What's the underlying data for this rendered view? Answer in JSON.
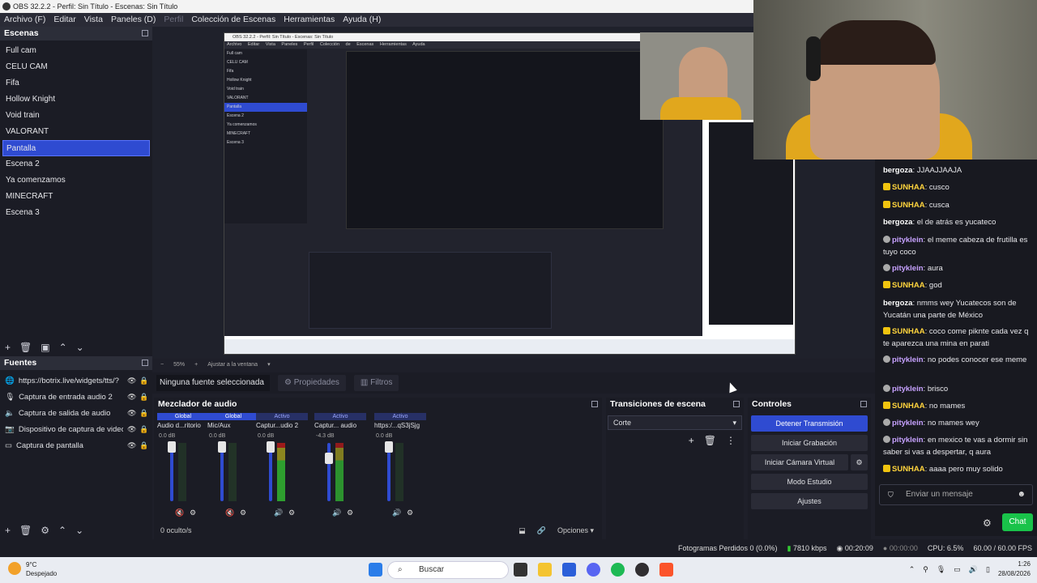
{
  "window": {
    "title": "OBS 32.2.2 - Perfil: Sin Título - Escenas: Sin Título"
  },
  "menu": [
    "Archivo (F)",
    "Editar",
    "Vista",
    "Paneles (D)",
    "Perfil",
    "Colección de Escenas",
    "Herramientas",
    "Ayuda (H)"
  ],
  "scenes": {
    "title": "Escenas",
    "items": [
      "Full cam",
      "CELU CAM",
      "Fifa",
      "Hollow Knight",
      "Void train",
      "VALORANT",
      "Pantalla",
      "Escena 2",
      "Ya comenzamos",
      "MINECRAFT",
      "Escena 3"
    ],
    "selected": "Pantalla"
  },
  "sources": {
    "title": "Fuentes",
    "items": [
      "https://botrix.live/widgets/tts/?",
      "Captura de entrada audio 2",
      "Captura de salida de audio",
      "Dispositivo de captura de video",
      "Captura de pantalla"
    ]
  },
  "preview_bar": {
    "zoom": "55%",
    "fit": "Ajustar a la ventana"
  },
  "context": {
    "no_source": "Ninguna fuente seleccionada",
    "properties": "Propiedades",
    "filters": "Filtros"
  },
  "mixer": {
    "title": "Mezclador de audio",
    "channels": [
      {
        "badge": "Global",
        "name": "Audio d...ritorio",
        "db": "0.0 dB",
        "level": 0.12
      },
      {
        "badge": "Global",
        "name": "Mic/Aux",
        "db": "0.0 dB",
        "level": 0.2
      },
      {
        "badge": "Activo",
        "name": "Captur...udio 2",
        "db": "0.0 dB",
        "level": 0.95
      },
      {
        "badge": "Activo",
        "name": "Captur... audio",
        "db": "-4.3 dB",
        "level": 0.8
      },
      {
        "badge": "Activo",
        "name": "https:/...qS3jSjg",
        "db": "0.0 dB",
        "level": 0.12
      }
    ],
    "scale": [
      "0",
      "-6",
      "-12",
      "-18",
      "-24",
      "-30",
      "-36",
      "-42",
      "-48",
      "-54",
      "-60"
    ],
    "hidden": "0 oculto/s",
    "options": "Opciones"
  },
  "transitions": {
    "title": "Transiciones de escena",
    "selected": "Corte"
  },
  "controls": {
    "title": "Controles",
    "buttons": [
      "Detener Transmisión",
      "Iniciar Grabación",
      "Iniciar Cámara Virtual",
      "Modo Estudio",
      "Ajustes"
    ]
  },
  "chat": {
    "messages": [
      {
        "user": "bergoza",
        "badge": "",
        "color": "white",
        "text": "JJAAJJAAJA"
      },
      {
        "user": "SUNHAA",
        "badge": "10",
        "color": "yellow",
        "text": "cusco"
      },
      {
        "user": "SUNHAA",
        "badge": "10",
        "color": "yellow",
        "text": "cusca"
      },
      {
        "user": "bergoza",
        "badge": "",
        "color": "white",
        "text": "el de atrás es yucateco"
      },
      {
        "user": "pityklein",
        "badge": "g",
        "color": "purple",
        "text": "el meme cabeza de frutilla es tuyo coco"
      },
      {
        "user": "pityklein",
        "badge": "g",
        "color": "purple",
        "text": "aura"
      },
      {
        "user": "SUNHAA",
        "badge": "10",
        "color": "yellow",
        "text": "god"
      },
      {
        "user": "bergoza",
        "badge": "",
        "color": "white",
        "text": "nmms wey Yucatecos son de Yucatán una parte de México"
      },
      {
        "user": "SUNHAA",
        "badge": "10",
        "color": "yellow",
        "text": "coco come piknte cada vez q te aparezca una mina en parati"
      },
      {
        "user": "pityklein",
        "badge": "g",
        "color": "purple",
        "text": "no podes conocer ese meme"
      },
      {
        "user": "pityklein",
        "badge": "g",
        "color": "purple",
        "text": "brisco"
      },
      {
        "user": "SUNHAA",
        "badge": "10",
        "color": "yellow",
        "text": "no mames"
      },
      {
        "user": "pityklein",
        "badge": "g",
        "color": "purple",
        "text": "no mames wey"
      },
      {
        "user": "pityklein",
        "badge": "g",
        "color": "purple",
        "text": "en mexico te vas a dormir sin saber si vas a despertar, q aura"
      },
      {
        "user": "SUNHAA",
        "badge": "10",
        "color": "yellow",
        "text": "aaaa pero muy solido"
      }
    ],
    "input_placeholder": "Enviar un mensaje",
    "send_label": "Chat"
  },
  "status": {
    "dropped": "Fotogramas Perdidos 0 (0.0%)",
    "bitrate": "7810 kbps",
    "stream_time": "00:20:09",
    "rec_time": "00:00:00",
    "cpu": "CPU: 6.5%",
    "fps": "60.00 / 60.00 FPS"
  },
  "taskbar": {
    "temp": "9°C",
    "weather": "Despejado",
    "search": "Buscar",
    "time": "1:26",
    "date": "28/08/2026"
  },
  "nested": {
    "title": "OBS 32.2.2 - Perfil: Sin Título - Escenas: Sin Título",
    "menu": "Archivo Editar Vista Paneles Perfil Colección de Escenas Herramientas Ayuda"
  }
}
